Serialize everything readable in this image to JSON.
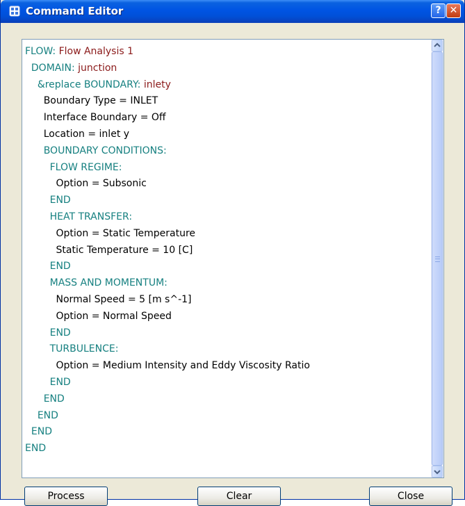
{
  "window": {
    "title": "Command Editor",
    "help_symbol": "?",
    "close_symbol": "✕",
    "icons": {
      "app": "command-editor-icon",
      "help": "help-icon",
      "close": "close-icon"
    }
  },
  "editor": {
    "lines": [
      {
        "indent": "",
        "parts": [
          {
            "text": "FLOW: ",
            "kind": "kw"
          },
          {
            "text": "Flow Analysis 1",
            "kind": "val"
          }
        ]
      },
      {
        "indent": "  ",
        "parts": [
          {
            "text": "DOMAIN: ",
            "kind": "kw"
          },
          {
            "text": "junction",
            "kind": "val"
          }
        ]
      },
      {
        "indent": "    ",
        "parts": [
          {
            "text": "&replace BOUNDARY: ",
            "kind": "kw"
          },
          {
            "text": "inlety",
            "kind": "val"
          }
        ]
      },
      {
        "indent": "      ",
        "parts": [
          {
            "text": "Boundary Type = INLET",
            "kind": "txt"
          }
        ]
      },
      {
        "indent": "      ",
        "parts": [
          {
            "text": "Interface Boundary = Off",
            "kind": "txt"
          }
        ]
      },
      {
        "indent": "      ",
        "parts": [
          {
            "text": "Location = inlet y",
            "kind": "txt"
          }
        ]
      },
      {
        "indent": "      ",
        "parts": [
          {
            "text": "BOUNDARY CONDITIONS:",
            "kind": "kw"
          }
        ]
      },
      {
        "indent": "        ",
        "parts": [
          {
            "text": "FLOW REGIME:",
            "kind": "kw"
          }
        ]
      },
      {
        "indent": "          ",
        "parts": [
          {
            "text": "Option = Subsonic",
            "kind": "txt"
          }
        ]
      },
      {
        "indent": "        ",
        "parts": [
          {
            "text": "END",
            "kind": "kw"
          }
        ]
      },
      {
        "indent": "        ",
        "parts": [
          {
            "text": "HEAT TRANSFER:",
            "kind": "kw"
          }
        ]
      },
      {
        "indent": "          ",
        "parts": [
          {
            "text": "Option = Static Temperature",
            "kind": "txt"
          }
        ]
      },
      {
        "indent": "          ",
        "parts": [
          {
            "text": "Static Temperature = 10 [C]",
            "kind": "txt"
          }
        ]
      },
      {
        "indent": "        ",
        "parts": [
          {
            "text": "END",
            "kind": "kw"
          }
        ]
      },
      {
        "indent": "        ",
        "parts": [
          {
            "text": "MASS AND MOMENTUM:",
            "kind": "kw"
          }
        ]
      },
      {
        "indent": "          ",
        "parts": [
          {
            "text": "Normal Speed = 5 [m s^-1]",
            "kind": "txt"
          }
        ]
      },
      {
        "indent": "          ",
        "parts": [
          {
            "text": "Option = Normal Speed",
            "kind": "txt"
          }
        ]
      },
      {
        "indent": "        ",
        "parts": [
          {
            "text": "END",
            "kind": "kw"
          }
        ]
      },
      {
        "indent": "        ",
        "parts": [
          {
            "text": "TURBULENCE:",
            "kind": "kw"
          }
        ]
      },
      {
        "indent": "          ",
        "parts": [
          {
            "text": "Option = Medium Intensity and Eddy Viscosity Ratio",
            "kind": "txt"
          }
        ]
      },
      {
        "indent": "        ",
        "parts": [
          {
            "text": "END",
            "kind": "kw"
          }
        ]
      },
      {
        "indent": "      ",
        "parts": [
          {
            "text": "END",
            "kind": "kw"
          }
        ]
      },
      {
        "indent": "    ",
        "parts": [
          {
            "text": "END",
            "kind": "kw"
          }
        ]
      },
      {
        "indent": "  ",
        "parts": [
          {
            "text": "END",
            "kind": "kw"
          }
        ]
      },
      {
        "indent": "",
        "parts": [
          {
            "text": "END",
            "kind": "kw"
          }
        ]
      }
    ],
    "colors": {
      "keyword": "#168080",
      "value": "#8b1a1a",
      "text": "#000000"
    }
  },
  "buttons": {
    "process": "Process",
    "clear": "Clear",
    "close": "Close"
  }
}
